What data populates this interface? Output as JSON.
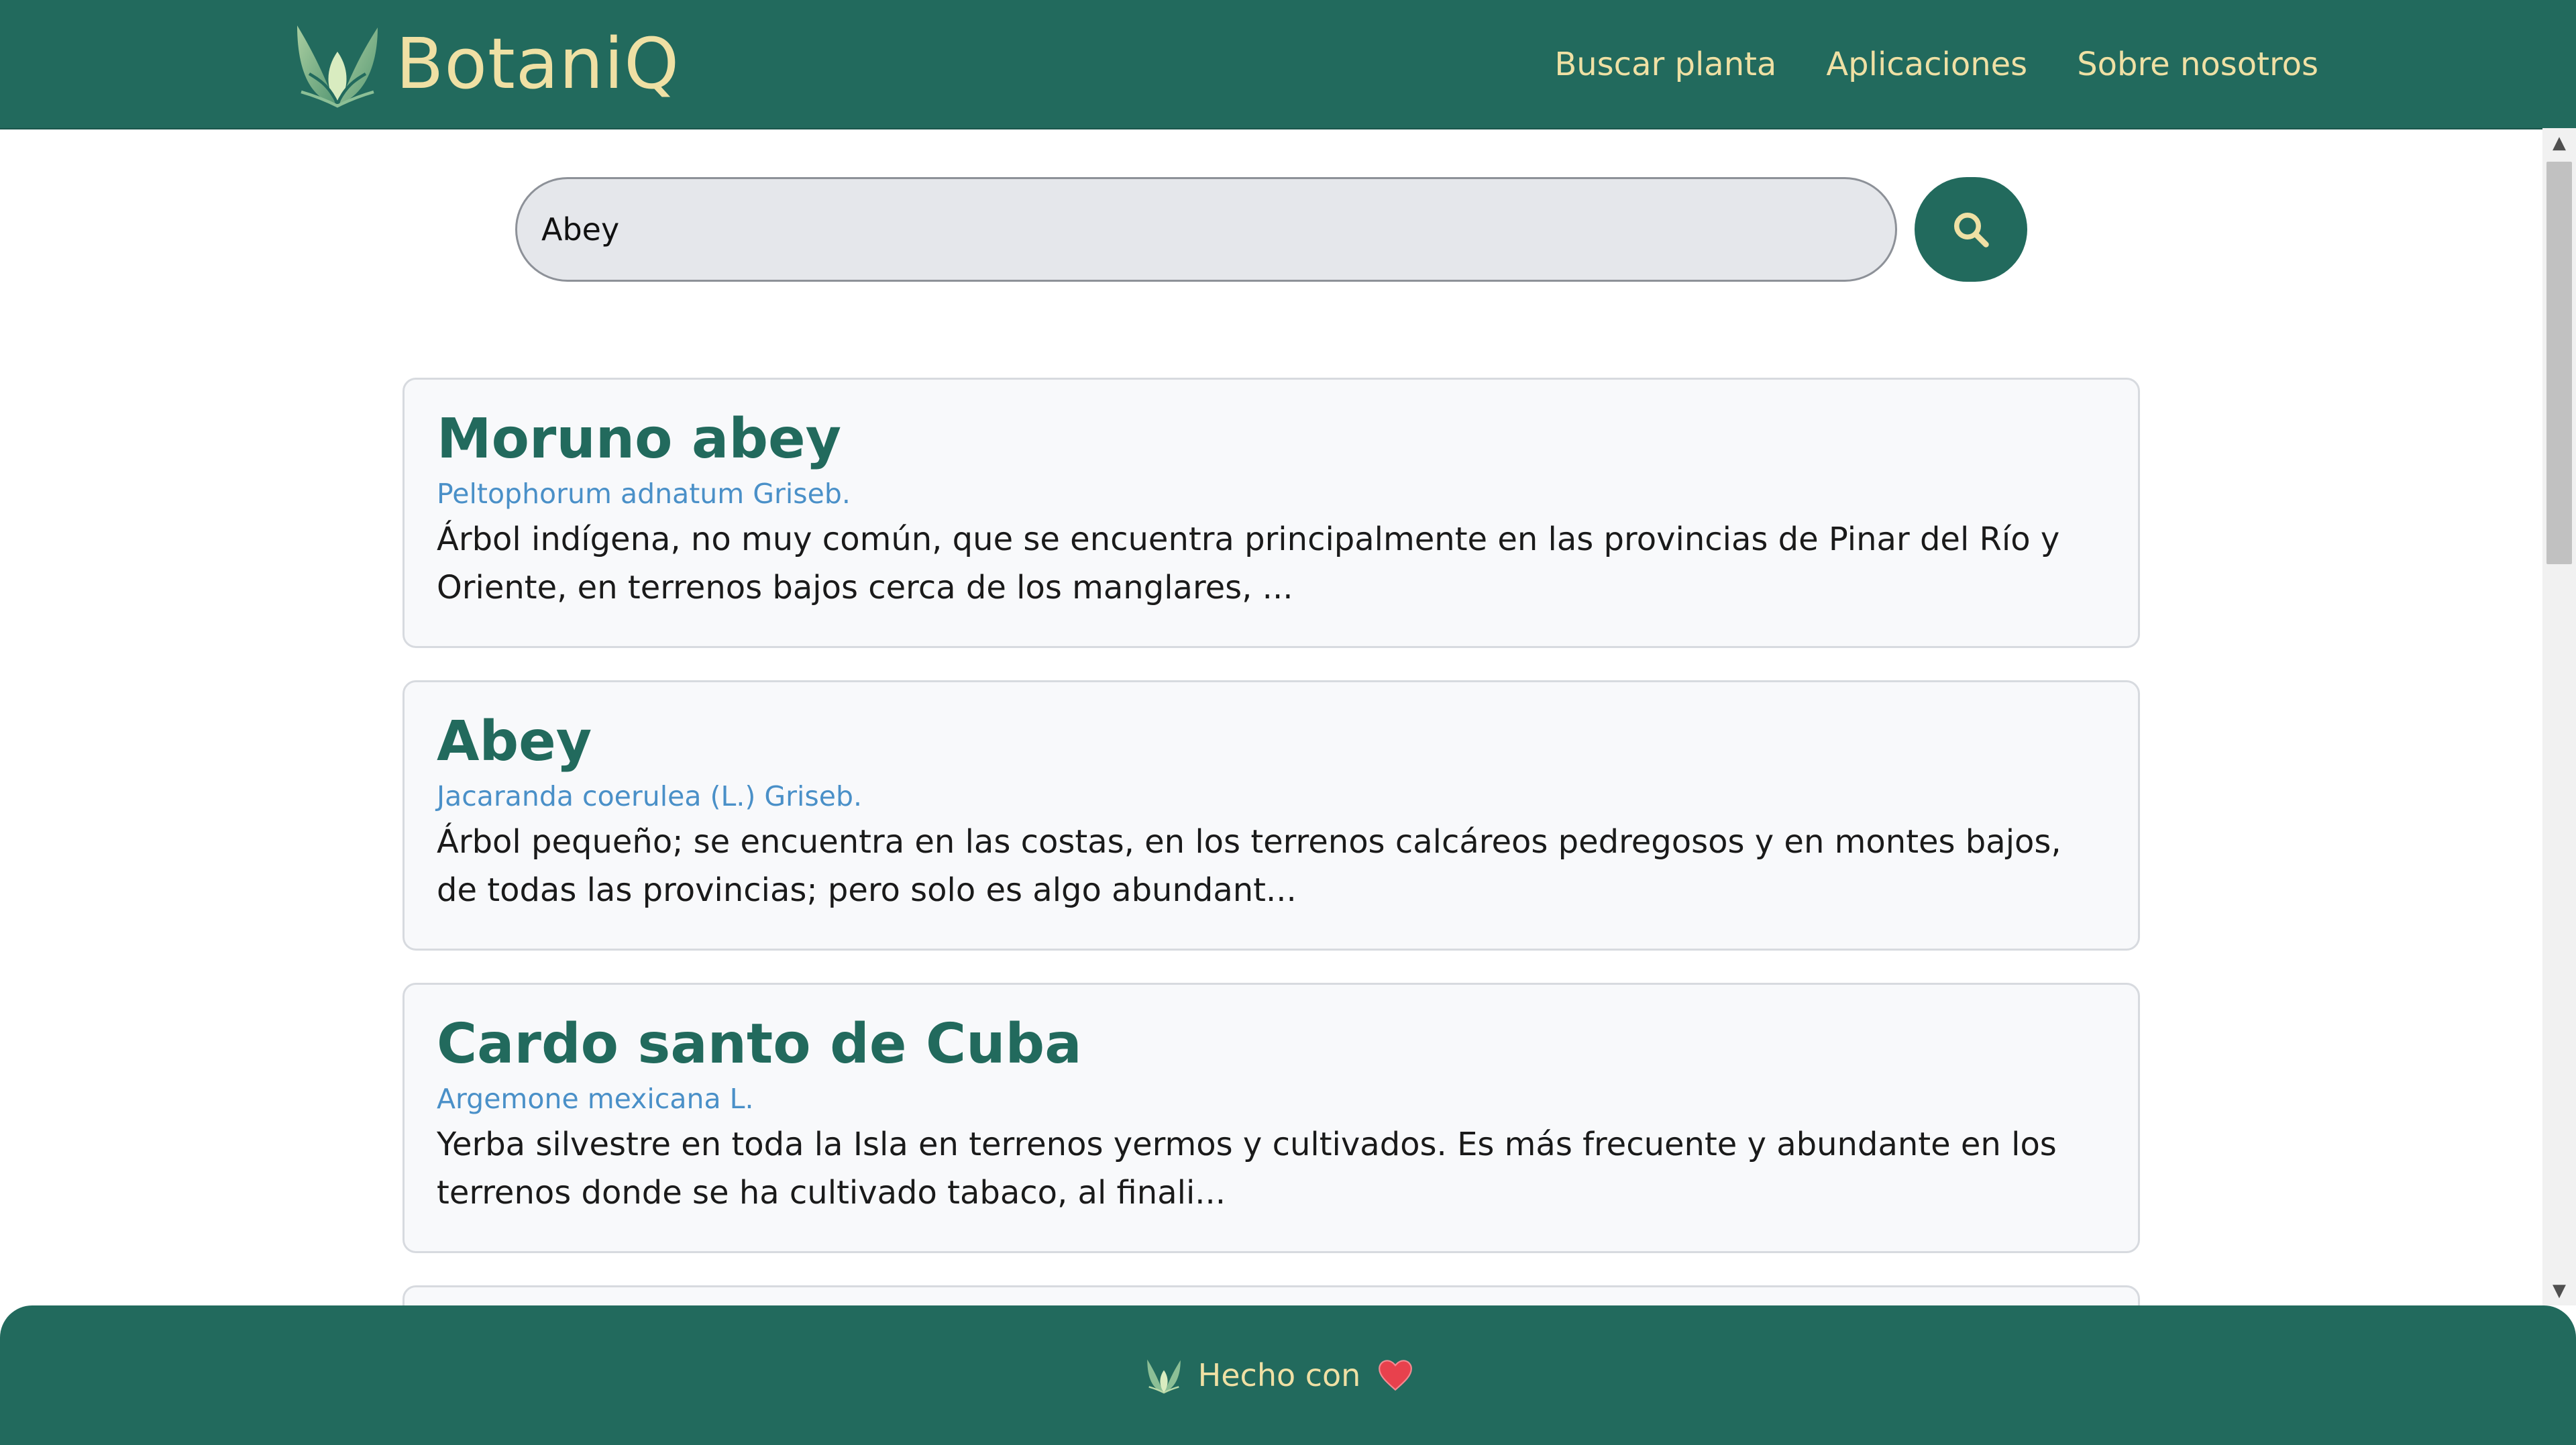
{
  "header": {
    "brand_name": "BotaniQ",
    "logo_icon": "leaf-logo-icon",
    "nav": [
      {
        "label": "Buscar planta"
      },
      {
        "label": "Aplicaciones"
      },
      {
        "label": "Sobre nosotros"
      }
    ]
  },
  "search": {
    "value": "Abey",
    "button_icon": "search-icon"
  },
  "results": [
    {
      "title": "Moruno abey",
      "scientific_name": "Peltophorum adnatum Griseb.",
      "description": "Árbol indígena, no muy común, que se encuentra principalmente en las provincias de Pinar del Río y Oriente, en terrenos bajos cerca de los manglares, ..."
    },
    {
      "title": "Abey",
      "scientific_name": "Jacaranda coerulea (L.) Griseb.",
      "description": "Árbol pequeño; se encuentra en las costas, en los terrenos calcáreos pedregosos y en montes bajos, de todas las provincias; pero solo es algo abundant..."
    },
    {
      "title": "Cardo santo de Cuba",
      "scientific_name": "Argemone mexicana L.",
      "description": "Yerba silvestre en toda la Isla en terrenos yermos y cultivados. Es más frecuente y abundante en los terrenos donde se ha cultivado tabaco, al finali..."
    }
  ],
  "footer": {
    "text": "Hecho con",
    "heart_icon": "heart-icon"
  },
  "colors": {
    "primary": "#226a5d",
    "accent": "#efe0a4",
    "link": "#4a90c8"
  }
}
